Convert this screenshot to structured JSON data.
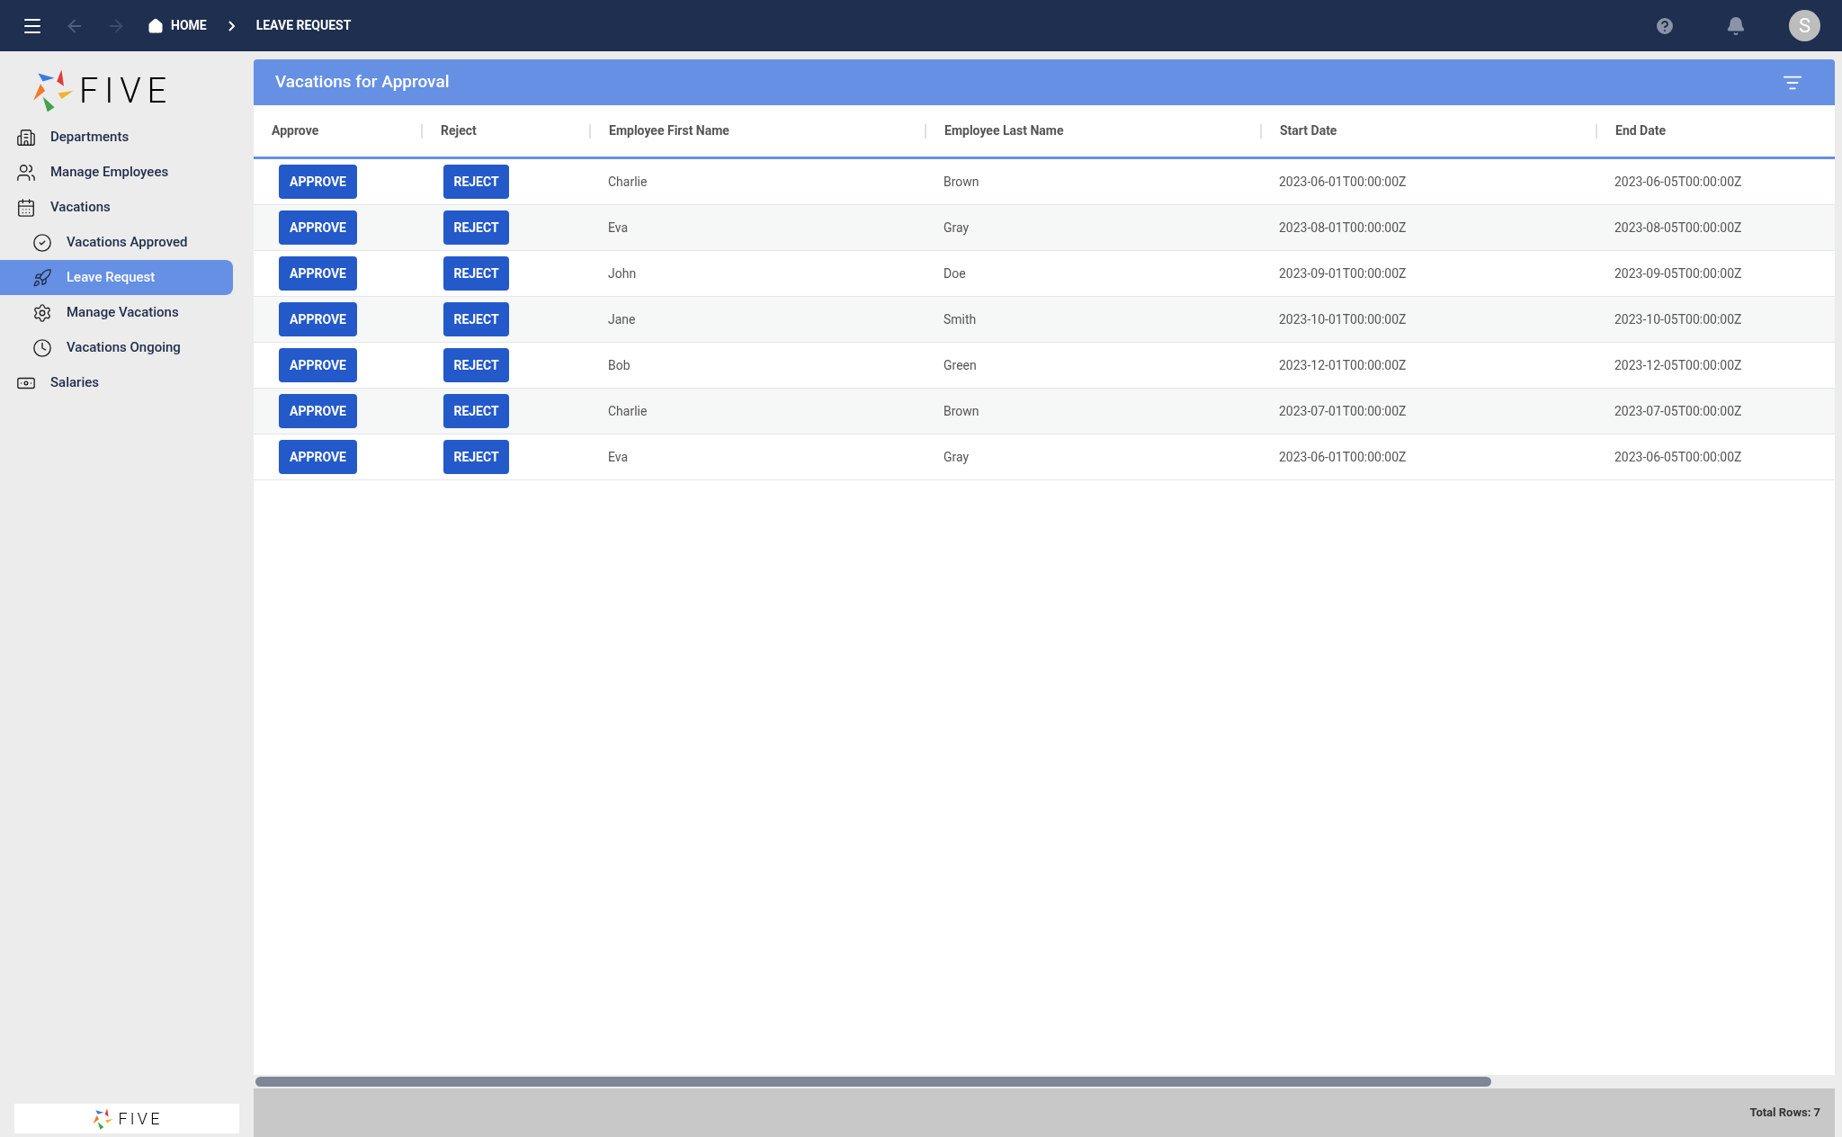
{
  "topbar": {
    "breadcrumbs": [
      {
        "label": "HOME",
        "kind": "home"
      },
      {
        "label": "LEAVE REQUEST",
        "kind": "page"
      }
    ],
    "avatar": "S"
  },
  "sidebar": {
    "logo": "FIVE",
    "items": [
      {
        "label": "Departments",
        "selected": false
      },
      {
        "label": "Manage Employees",
        "selected": false
      },
      {
        "label": "Vacations",
        "selected": false,
        "children": [
          {
            "label": "Vacations Approved",
            "selected": false
          },
          {
            "label": "Leave Request",
            "selected": true
          },
          {
            "label": "Manage Vacations",
            "selected": false
          },
          {
            "label": "Vacations Ongoing",
            "selected": false
          }
        ]
      },
      {
        "label": "Salaries",
        "selected": false
      }
    ],
    "footer_logo": "FIVE"
  },
  "panel": {
    "title": "Vacations for Approval",
    "table": {
      "columns": [
        "Approve",
        "Reject",
        "Employee First Name",
        "Employee Last Name",
        "Start Date",
        "End Date"
      ],
      "rows": [
        {
          "approve": "APPROVE",
          "reject": "REJECT",
          "first": "Charlie",
          "last": "Brown",
          "start": "2023-06-01T00:00:00Z",
          "end": "2023-06-05T00:00:00Z"
        },
        {
          "approve": "APPROVE",
          "reject": "REJECT",
          "first": "Eva",
          "last": "Gray",
          "start": "2023-08-01T00:00:00Z",
          "end": "2023-08-05T00:00:00Z"
        },
        {
          "approve": "APPROVE",
          "reject": "REJECT",
          "first": "John",
          "last": "Doe",
          "start": "2023-09-01T00:00:00Z",
          "end": "2023-09-05T00:00:00Z"
        },
        {
          "approve": "APPROVE",
          "reject": "REJECT",
          "first": "Jane",
          "last": "Smith",
          "start": "2023-10-01T00:00:00Z",
          "end": "2023-10-05T00:00:00Z"
        },
        {
          "approve": "APPROVE",
          "reject": "REJECT",
          "first": "Bob",
          "last": "Green",
          "start": "2023-12-01T00:00:00Z",
          "end": "2023-12-05T00:00:00Z"
        },
        {
          "approve": "APPROVE",
          "reject": "REJECT",
          "first": "Charlie",
          "last": "Brown",
          "start": "2023-07-01T00:00:00Z",
          "end": "2023-07-05T00:00:00Z"
        },
        {
          "approve": "APPROVE",
          "reject": "REJECT",
          "first": "Eva",
          "last": "Gray",
          "start": "2023-06-01T00:00:00Z",
          "end": "2023-06-05T00:00:00Z"
        }
      ]
    },
    "total_rows": "Total Rows: 7"
  }
}
